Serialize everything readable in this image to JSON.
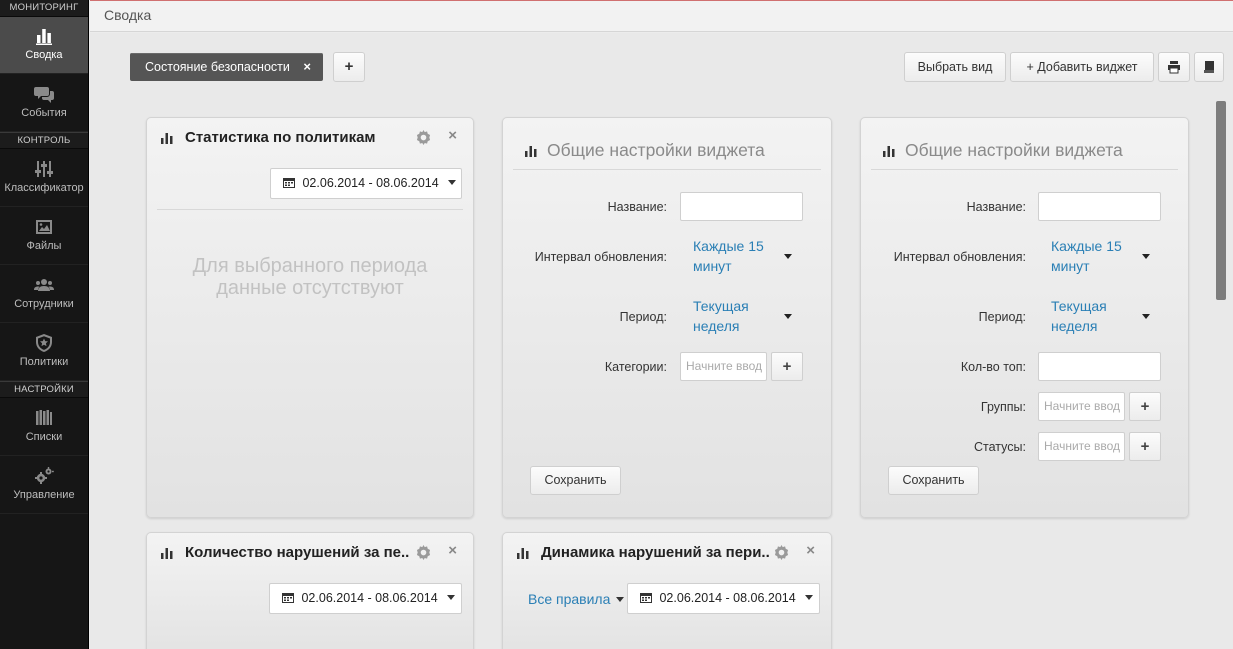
{
  "sidebar": {
    "sections": {
      "monitoring": "МОНИТОРИНГ",
      "control": "КОНТРОЛЬ",
      "settings": "НАСТРОЙКИ"
    },
    "items": [
      {
        "label": "Сводка",
        "icon": "bar-chart-icon",
        "active": true
      },
      {
        "label": "События",
        "icon": "chat-bubbles-icon"
      },
      {
        "label": "Классификатор",
        "icon": "sliders-icon"
      },
      {
        "label": "Файлы",
        "icon": "image-file-icon"
      },
      {
        "label": "Сотрудники",
        "icon": "users-icon"
      },
      {
        "label": "Политики",
        "icon": "shield-star-icon"
      },
      {
        "label": "Списки",
        "icon": "list-books-icon"
      },
      {
        "label": "Управление",
        "icon": "gears-icon"
      }
    ]
  },
  "topbar": {
    "breadcrumb": "Сводка"
  },
  "toolbar": {
    "tab_label": "Состояние безопасности",
    "tab_close": "×",
    "add_tab": "+",
    "choose_view": "Выбрать вид",
    "add_widget": "+ Добавить виджет"
  },
  "widgets": {
    "policy_stats": {
      "title": "Статистика по политикам",
      "date_range": "02.06.2014 - 08.06.2014",
      "empty_message_line1": "Для выбранного периода",
      "empty_message_line2": "данные отсутствуют",
      "close": "×"
    },
    "settings_1": {
      "title": "Общие настройки виджета",
      "name_label": "Название:",
      "name_value": "",
      "interval_label": "Интервал обновления:",
      "interval_value_line1": "Каждые 15",
      "interval_value_line2": "минут",
      "period_label": "Период:",
      "period_value_line1": "Текущая",
      "period_value_line2": "неделя",
      "categories_label": "Категории:",
      "categories_placeholder": "Начните ввод",
      "save": "Сохранить"
    },
    "settings_2": {
      "title": "Общие настройки виджета",
      "name_label": "Название:",
      "name_value": "",
      "interval_label": "Интервал обновления:",
      "interval_value_line1": "Каждые 15",
      "interval_value_line2": "минут",
      "period_label": "Период:",
      "period_value_line1": "Текущая",
      "period_value_line2": "неделя",
      "top_count_label": "Кол-во топ:",
      "top_count_value": "",
      "groups_label": "Группы:",
      "groups_placeholder": "Начните ввод",
      "statuses_label": "Статусы:",
      "statuses_placeholder": "Начните ввод",
      "save": "Сохранить"
    },
    "violations_count": {
      "title": "Количество нарушений за пе..",
      "date_range": "02.06.2014 - 08.06.2014",
      "close": "×"
    },
    "violations_dynamics": {
      "title": "Динамика нарушений за пери..",
      "rules_filter": "Все правила",
      "date_range": "02.06.2014 - 08.06.2014",
      "close": "×"
    }
  },
  "colors": {
    "sidebar_bg": "#161616",
    "active_item_bg": "#4b4b4b",
    "link_blue": "#2a7fb5",
    "tab_chip_bg": "#555555"
  }
}
